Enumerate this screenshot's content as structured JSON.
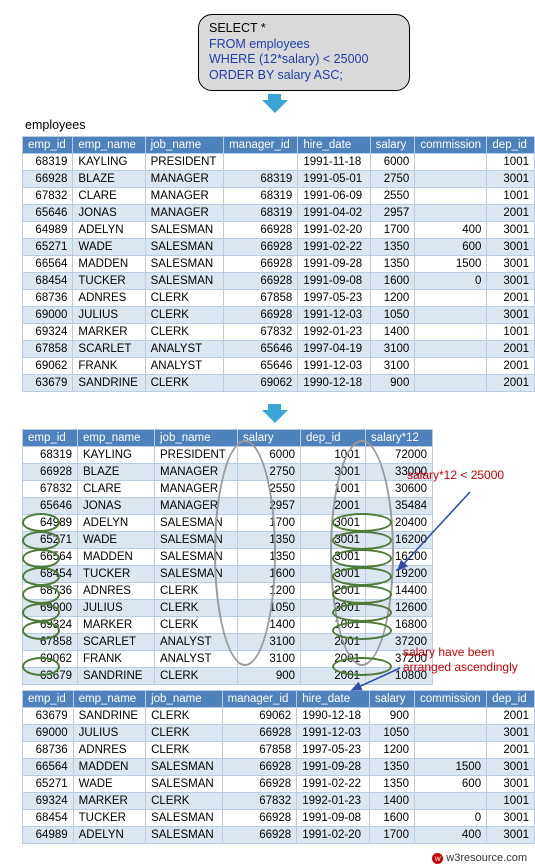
{
  "sql": {
    "lines": [
      {
        "text": "SELECT *",
        "color": "black"
      },
      {
        "text": "FROM employees",
        "color": "blue"
      },
      {
        "text": "WHERE (12*salary) < 25000",
        "color": "blue"
      },
      {
        "text": "ORDER BY salary ASC;",
        "color": "blue"
      }
    ]
  },
  "caption": "employees",
  "table1": {
    "headers": [
      "emp_id",
      "emp_name",
      "job_name",
      "manager_id",
      "hire_date",
      "salary",
      "commission",
      "dep_id"
    ],
    "rows": [
      [
        "68319",
        "KAYLING",
        "PRESIDENT",
        "",
        "1991-11-18",
        "6000",
        "",
        "1001"
      ],
      [
        "66928",
        "BLAZE",
        "MANAGER",
        "68319",
        "1991-05-01",
        "2750",
        "",
        "3001"
      ],
      [
        "67832",
        "CLARE",
        "MANAGER",
        "68319",
        "1991-06-09",
        "2550",
        "",
        "1001"
      ],
      [
        "65646",
        "JONAS",
        "MANAGER",
        "68319",
        "1991-04-02",
        "2957",
        "",
        "2001"
      ],
      [
        "64989",
        "ADELYN",
        "SALESMAN",
        "66928",
        "1991-02-20",
        "1700",
        "400",
        "3001"
      ],
      [
        "65271",
        "WADE",
        "SALESMAN",
        "66928",
        "1991-02-22",
        "1350",
        "600",
        "3001"
      ],
      [
        "66564",
        "MADDEN",
        "SALESMAN",
        "66928",
        "1991-09-28",
        "1350",
        "1500",
        "3001"
      ],
      [
        "68454",
        "TUCKER",
        "SALESMAN",
        "66928",
        "1991-09-08",
        "1600",
        "0",
        "3001"
      ],
      [
        "68736",
        "ADNRES",
        "CLERK",
        "67858",
        "1997-05-23",
        "1200",
        "",
        "2001"
      ],
      [
        "69000",
        "JULIUS",
        "CLERK",
        "66928",
        "1991-12-03",
        "1050",
        "",
        "3001"
      ],
      [
        "69324",
        "MARKER",
        "CLERK",
        "67832",
        "1992-01-23",
        "1400",
        "",
        "1001"
      ],
      [
        "67858",
        "SCARLET",
        "ANALYST",
        "65646",
        "1997-04-19",
        "3100",
        "",
        "2001"
      ],
      [
        "69062",
        "FRANK",
        "ANALYST",
        "65646",
        "1991-12-03",
        "3100",
        "",
        "2001"
      ],
      [
        "63679",
        "SANDRINE",
        "CLERK",
        "69062",
        "1990-12-18",
        "900",
        "",
        "2001"
      ]
    ]
  },
  "table2": {
    "headers": [
      "emp_id",
      "emp_name",
      "job_name",
      "salary",
      "dep_id",
      "salary*12"
    ],
    "rows": [
      [
        "68319",
        "KAYLING",
        "PRESIDENT",
        "6000",
        "1001",
        "72000"
      ],
      [
        "66928",
        "BLAZE",
        "MANAGER",
        "2750",
        "3001",
        "33000"
      ],
      [
        "67832",
        "CLARE",
        "MANAGER",
        "2550",
        "1001",
        "30600"
      ],
      [
        "65646",
        "JONAS",
        "MANAGER",
        "2957",
        "2001",
        "35484"
      ],
      [
        "64989",
        "ADELYN",
        "SALESMAN",
        "1700",
        "3001",
        "20400"
      ],
      [
        "65271",
        "WADE",
        "SALESMAN",
        "1350",
        "3001",
        "16200"
      ],
      [
        "66564",
        "MADDEN",
        "SALESMAN",
        "1350",
        "3001",
        "16200"
      ],
      [
        "68454",
        "TUCKER",
        "SALESMAN",
        "1600",
        "3001",
        "19200"
      ],
      [
        "68736",
        "ADNRES",
        "CLERK",
        "1200",
        "2001",
        "14400"
      ],
      [
        "69000",
        "JULIUS",
        "CLERK",
        "1050",
        "3001",
        "12600"
      ],
      [
        "69324",
        "MARKER",
        "CLERK",
        "1400",
        "1001",
        "16800"
      ],
      [
        "67858",
        "SCARLET",
        "ANALYST",
        "3100",
        "2001",
        "37200"
      ],
      [
        "69062",
        "FRANK",
        "ANALYST",
        "3100",
        "2001",
        "37200"
      ],
      [
        "63679",
        "SANDRINE",
        "CLERK",
        "900",
        "2001",
        "10800"
      ]
    ]
  },
  "table3": {
    "headers": [
      "emp_id",
      "emp_name",
      "job_name",
      "manager_id",
      "hire_date",
      "salary",
      "commission",
      "dep_id"
    ],
    "rows": [
      [
        "63679",
        "SANDRINE",
        "CLERK",
        "69062",
        "1990-12-18",
        "900",
        "",
        "2001"
      ],
      [
        "69000",
        "JULIUS",
        "CLERK",
        "66928",
        "1991-12-03",
        "1050",
        "",
        "3001"
      ],
      [
        "68736",
        "ADNRES",
        "CLERK",
        "67858",
        "1997-05-23",
        "1200",
        "",
        "2001"
      ],
      [
        "66564",
        "MADDEN",
        "SALESMAN",
        "66928",
        "1991-09-28",
        "1350",
        "1500",
        "3001"
      ],
      [
        "65271",
        "WADE",
        "SALESMAN",
        "66928",
        "1991-02-22",
        "1350",
        "600",
        "3001"
      ],
      [
        "69324",
        "MARKER",
        "CLERK",
        "67832",
        "1992-01-23",
        "1400",
        "",
        "1001"
      ],
      [
        "68454",
        "TUCKER",
        "SALESMAN",
        "66928",
        "1991-09-08",
        "1600",
        "0",
        "3001"
      ],
      [
        "64989",
        "ADELYN",
        "SALESMAN",
        "66928",
        "1991-02-20",
        "1700",
        "400",
        "3001"
      ]
    ]
  },
  "annotations": {
    "filter_note": "salary*12 < 25000",
    "sort_note_line1": "salary have been",
    "sort_note_line2": "arranged ascendingly"
  },
  "footer": {
    "text": "w3resource.com",
    "logo_glyph": "w"
  },
  "colors": {
    "header_blue": "#4f81bd",
    "row_alt": "#dce6f1",
    "arrow_blue": "#3aa6d6",
    "annot_red": "#cc0000",
    "ellipse_green": "#4e7a3a",
    "sql_blue": "#1f3fa8",
    "sql_bg": "#d9d9d9"
  }
}
